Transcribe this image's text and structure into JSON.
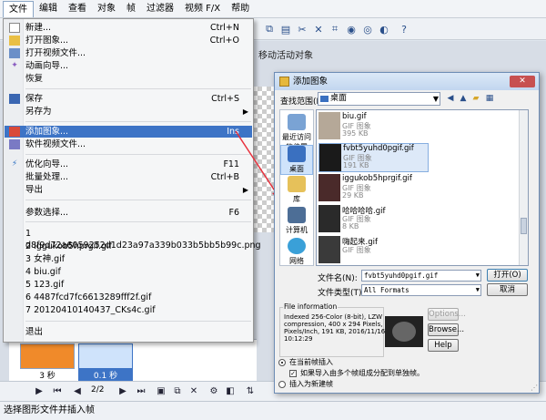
{
  "menubar": [
    "文件",
    "编辑",
    "查看",
    "对象",
    "帧",
    "过滤器",
    "视频 F/X",
    "帮助"
  ],
  "work_hint": "移动活动对象",
  "file_menu": {
    "items": [
      {
        "label": "新建...",
        "shortcut": "Ctrl+N",
        "icon": "new-file-icon"
      },
      {
        "label": "打开图象...",
        "shortcut": "Ctrl+O",
        "icon": "open-folder-icon"
      },
      {
        "label": "打开视频文件...",
        "shortcut": "",
        "icon": "video-icon"
      },
      {
        "label": "动画向导...",
        "shortcut": "",
        "icon": "wizard-icon"
      },
      {
        "label": "恢复",
        "shortcut": "",
        "icon": ""
      },
      {
        "label": "保存",
        "shortcut": "Ctrl+S",
        "icon": "save-icon"
      },
      {
        "label": "另存为",
        "shortcut": "",
        "icon": "",
        "submenu": true
      },
      {
        "label": "添加图象...",
        "shortcut": "Ins",
        "icon": "add-image-icon",
        "highlighted": true
      },
      {
        "label": "软件视频文件...",
        "shortcut": "",
        "icon": "video-file-icon"
      },
      {
        "label": "优化向导...",
        "shortcut": "F11",
        "icon": "optimize-icon"
      },
      {
        "label": "批量处理...",
        "shortcut": "Ctrl+B",
        "icon": ""
      },
      {
        "label": "导出",
        "shortcut": "",
        "icon": "",
        "submenu": true
      },
      {
        "label": "参数选择...",
        "shortcut": "F6",
        "icon": ""
      },
      {
        "label": "1 d8f9d72a6059252d1d23a97a339b033b5bb5b99c.png",
        "shortcut": "",
        "icon": ""
      },
      {
        "label": "2 iggukob5hprgif.gif",
        "shortcut": "",
        "icon": ""
      },
      {
        "label": "3 女神.gif",
        "shortcut": "",
        "icon": ""
      },
      {
        "label": "4 biu.gif",
        "shortcut": "",
        "icon": ""
      },
      {
        "label": "5 123.gif",
        "shortcut": "",
        "icon": ""
      },
      {
        "label": "6 4487fcd7fc6613289fff2f.gif",
        "shortcut": "",
        "icon": ""
      },
      {
        "label": "7 20120410140437_CKs4c.gif",
        "shortcut": "",
        "icon": ""
      },
      {
        "label": "退出",
        "shortcut": "",
        "icon": ""
      }
    ]
  },
  "thumbs": [
    "3 秒",
    "0.1 秒"
  ],
  "frame_counter": "2/2",
  "status": "选择图形文件并插入帧",
  "dialog": {
    "title": "添加图象",
    "close": "✕",
    "look_in_label": "查找范围(I):",
    "look_in_value": "桌面",
    "places": [
      "最近访问的位置",
      "桌面",
      "库",
      "计算机",
      "网络"
    ],
    "files": [
      {
        "name": "biu.gif",
        "type": "GIF 图象",
        "size": "395 KB"
      },
      {
        "name": "fvbt5yuhd0pgif.gif",
        "type": "GIF 图象",
        "size": "191 KB"
      },
      {
        "name": "iggukob5hprgif.gif",
        "type": "GIF 图象",
        "size": "29 KB"
      },
      {
        "name": "哈哈哈哈.gif",
        "type": "GIF 图象",
        "size": "8 KB"
      },
      {
        "name": "嗨起来.gif",
        "type": "GIF 图象",
        "size": ""
      }
    ],
    "filename_label": "文件名(N):",
    "filename_value": "fvbt5yuhd0pgif.gif",
    "filetype_label": "文件类型(T):",
    "filetype_value": "All Formats",
    "open_button": "打开(O)",
    "cancel_button": "取消",
    "info_title": "File information",
    "info_text": "Indexed 256-Color (8-bit), LZW\ncompression, 400 x 294 Pixels, (96, 96)\nPixels/Inch, 191 KB, 2016/11/16\n10:12:29",
    "options_button": "Options...",
    "browse_button": "Browse...",
    "help_button": "Help",
    "radio_current": "在当前帧插入",
    "check_split": "如果导入由多个帧组成分配到单独帧。",
    "radio_new": "插入为新建帧"
  },
  "colors": {
    "highlight": "#3d74c6",
    "arrow": "#e8303c"
  }
}
